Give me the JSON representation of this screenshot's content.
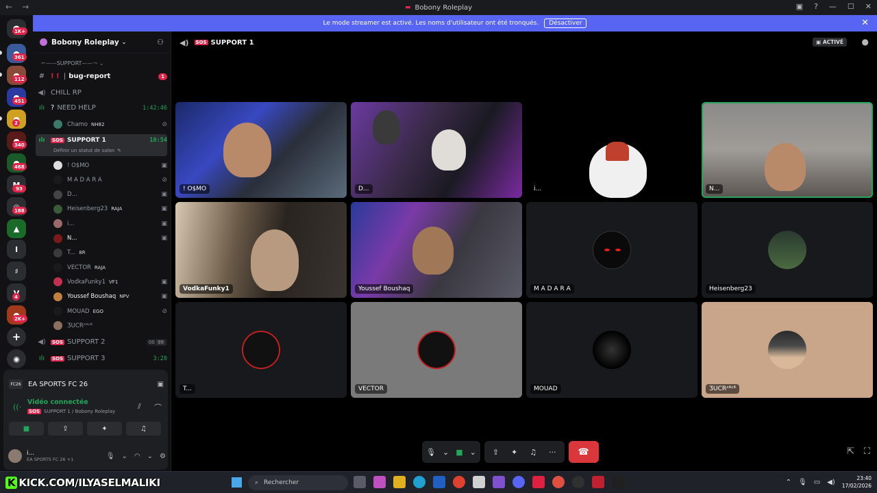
{
  "titlebar": {
    "title": "Bobony Roleplay"
  },
  "banner": {
    "text": "Le mode streamer est activé. Les noms d'utilisateur ont été tronqués.",
    "button": "Désactiver"
  },
  "rail_badges": [
    "1K+",
    "361",
    "112",
    "451",
    "2",
    "340",
    "468",
    "93",
    "188",
    "4",
    "2K+"
  ],
  "server": {
    "name": "Bobony Roleplay"
  },
  "channels": {
    "category": "SUPPORT",
    "bug_report": "bug-report",
    "bug_badge": "1",
    "chill": "CHILL RP",
    "need_help": "NEED HELP",
    "need_help_time": "1:42:46",
    "chamo": "Chamo",
    "chamo_badge": "NH82",
    "support1": "SUPPORT 1",
    "support1_time": "18:54",
    "support1_status": "Définir un statut de salon",
    "support2": "SUPPORT 2",
    "support2_count_a": "00",
    "support2_count_b": "99",
    "support3": "SUPPORT 3",
    "support3_time": "3:28",
    "tag": "SOS"
  },
  "voice_users": [
    {
      "name": "! O$MO",
      "badge": ""
    },
    {
      "name": "M A D A R A",
      "badge": ""
    },
    {
      "name": "D...",
      "badge": ""
    },
    {
      "name": "Heisenberg23",
      "badge": "RAJA"
    },
    {
      "name": "i...",
      "badge": ""
    },
    {
      "name": "N...",
      "badge": ""
    },
    {
      "name": "T...",
      "badge": "8R"
    },
    {
      "name": "VECTOR",
      "badge": "RAJA"
    },
    {
      "name": "VodkaFunky1",
      "badge": "VF1"
    },
    {
      "name": "Youssef Boushaq",
      "badge": "NPV"
    },
    {
      "name": "MOUAD",
      "badge": "EGO"
    },
    {
      "name": "ƷUCRᶻᴬᶜᴷ",
      "badge": ""
    }
  ],
  "panel": {
    "game": "EA SPORTS FC 26",
    "game_logo": "FC26",
    "voice_status": "Vidéo connectée",
    "voice_channel": "SUPPORT 1 / Bobony Roleplay",
    "user_name": "i...",
    "user_activity": "EA SPORTS FC 26 +1"
  },
  "main": {
    "channel": "SUPPORT 1",
    "active_label": "ACTIVÉ"
  },
  "tiles": [
    {
      "label": "! O$MO"
    },
    {
      "label": "D..."
    },
    {
      "label": "i..."
    },
    {
      "label": "N..."
    },
    {
      "label": "VodkaFunky1"
    },
    {
      "label": "Youssef Boushaq"
    },
    {
      "label": "M A D A R A"
    },
    {
      "label": "Heisenberg23"
    },
    {
      "label": "T..."
    },
    {
      "label": "VECTOR"
    },
    {
      "label": "MOUAD"
    },
    {
      "label": "ƷUCRᶻᴬᶜᴷ"
    }
  ],
  "taskbar": {
    "kick_url": "KICK.COM/ILYASELMALIKI",
    "search_placeholder": "Rechercher",
    "time": "23:40",
    "date": "17/02/2026"
  }
}
